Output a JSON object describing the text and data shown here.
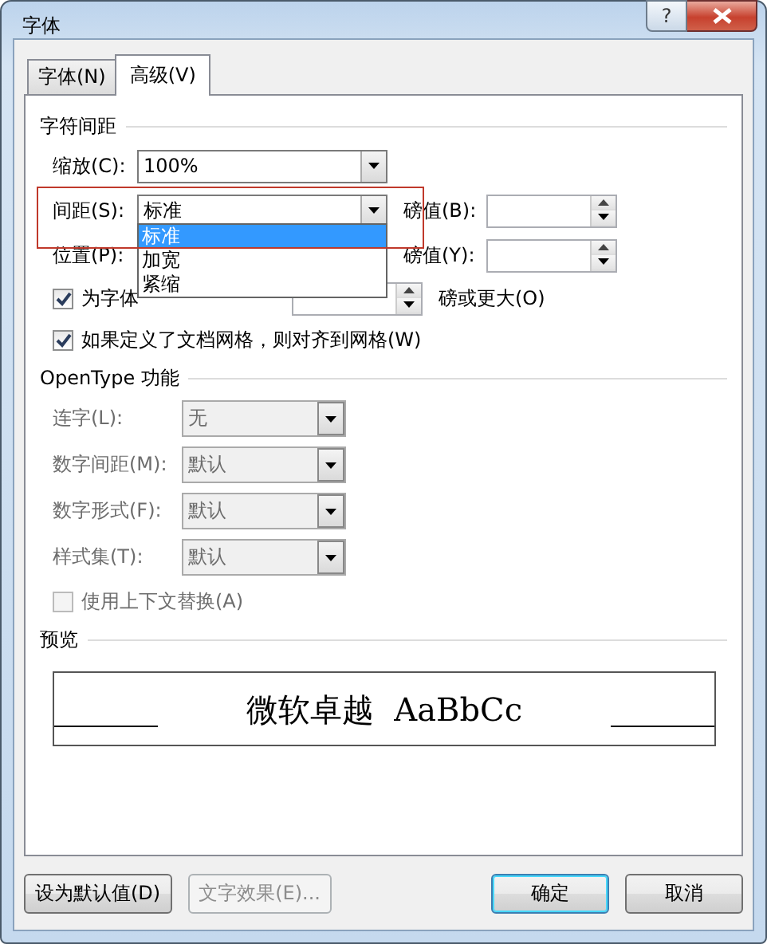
{
  "window": {
    "title": "字体",
    "help_label": "?"
  },
  "tabs": [
    {
      "label": "字体(N)",
      "selected": false
    },
    {
      "label": "高级(V)",
      "selected": true
    }
  ],
  "spacing_section": {
    "title": "字符间距",
    "scale": {
      "label": "缩放(C):",
      "value": "100%"
    },
    "spacing": {
      "label": "间距(S):",
      "value": "标准",
      "highlighted": true,
      "expanded": true,
      "points_label": "磅值(B):",
      "options": [
        {
          "label": "标准",
          "selected": true
        },
        {
          "label": "加宽",
          "selected": false
        },
        {
          "label": "紧缩",
          "selected": false
        }
      ]
    },
    "position": {
      "label": "位置(P):",
      "points_label": "磅值(Y):"
    },
    "checkboxes": [
      {
        "kind": "kerning",
        "label": "为字体",
        "checked": true,
        "suffix": "磅或更大(O)"
      },
      {
        "kind": "plain",
        "label": "如果定义了文档网格，则对齐到网格(W)",
        "checked": true
      }
    ]
  },
  "opentype_section": {
    "title": "OpenType 功能",
    "rows": [
      {
        "label": "连字(L):",
        "value": "无",
        "disabled": true
      },
      {
        "label": "数字间距(M):",
        "value": "默认",
        "disabled": true
      },
      {
        "label": "数字形式(F):",
        "value": "默认",
        "disabled": true
      },
      {
        "label": "样式集(T):",
        "value": "默认",
        "disabled": true
      }
    ],
    "contextual": {
      "label": "使用上下文替换(A)",
      "checked": false,
      "disabled": true
    }
  },
  "preview": {
    "title": "预览",
    "sample": "微软卓越  AaBbCc"
  },
  "buttons": [
    {
      "label": "设为默认值(D)",
      "disabled": false,
      "default": false
    },
    {
      "label": "文字效果(E)...",
      "disabled": true,
      "default": false
    },
    {
      "label": "确定",
      "disabled": false,
      "default": true
    },
    {
      "label": "取消",
      "disabled": false,
      "default": false
    }
  ]
}
